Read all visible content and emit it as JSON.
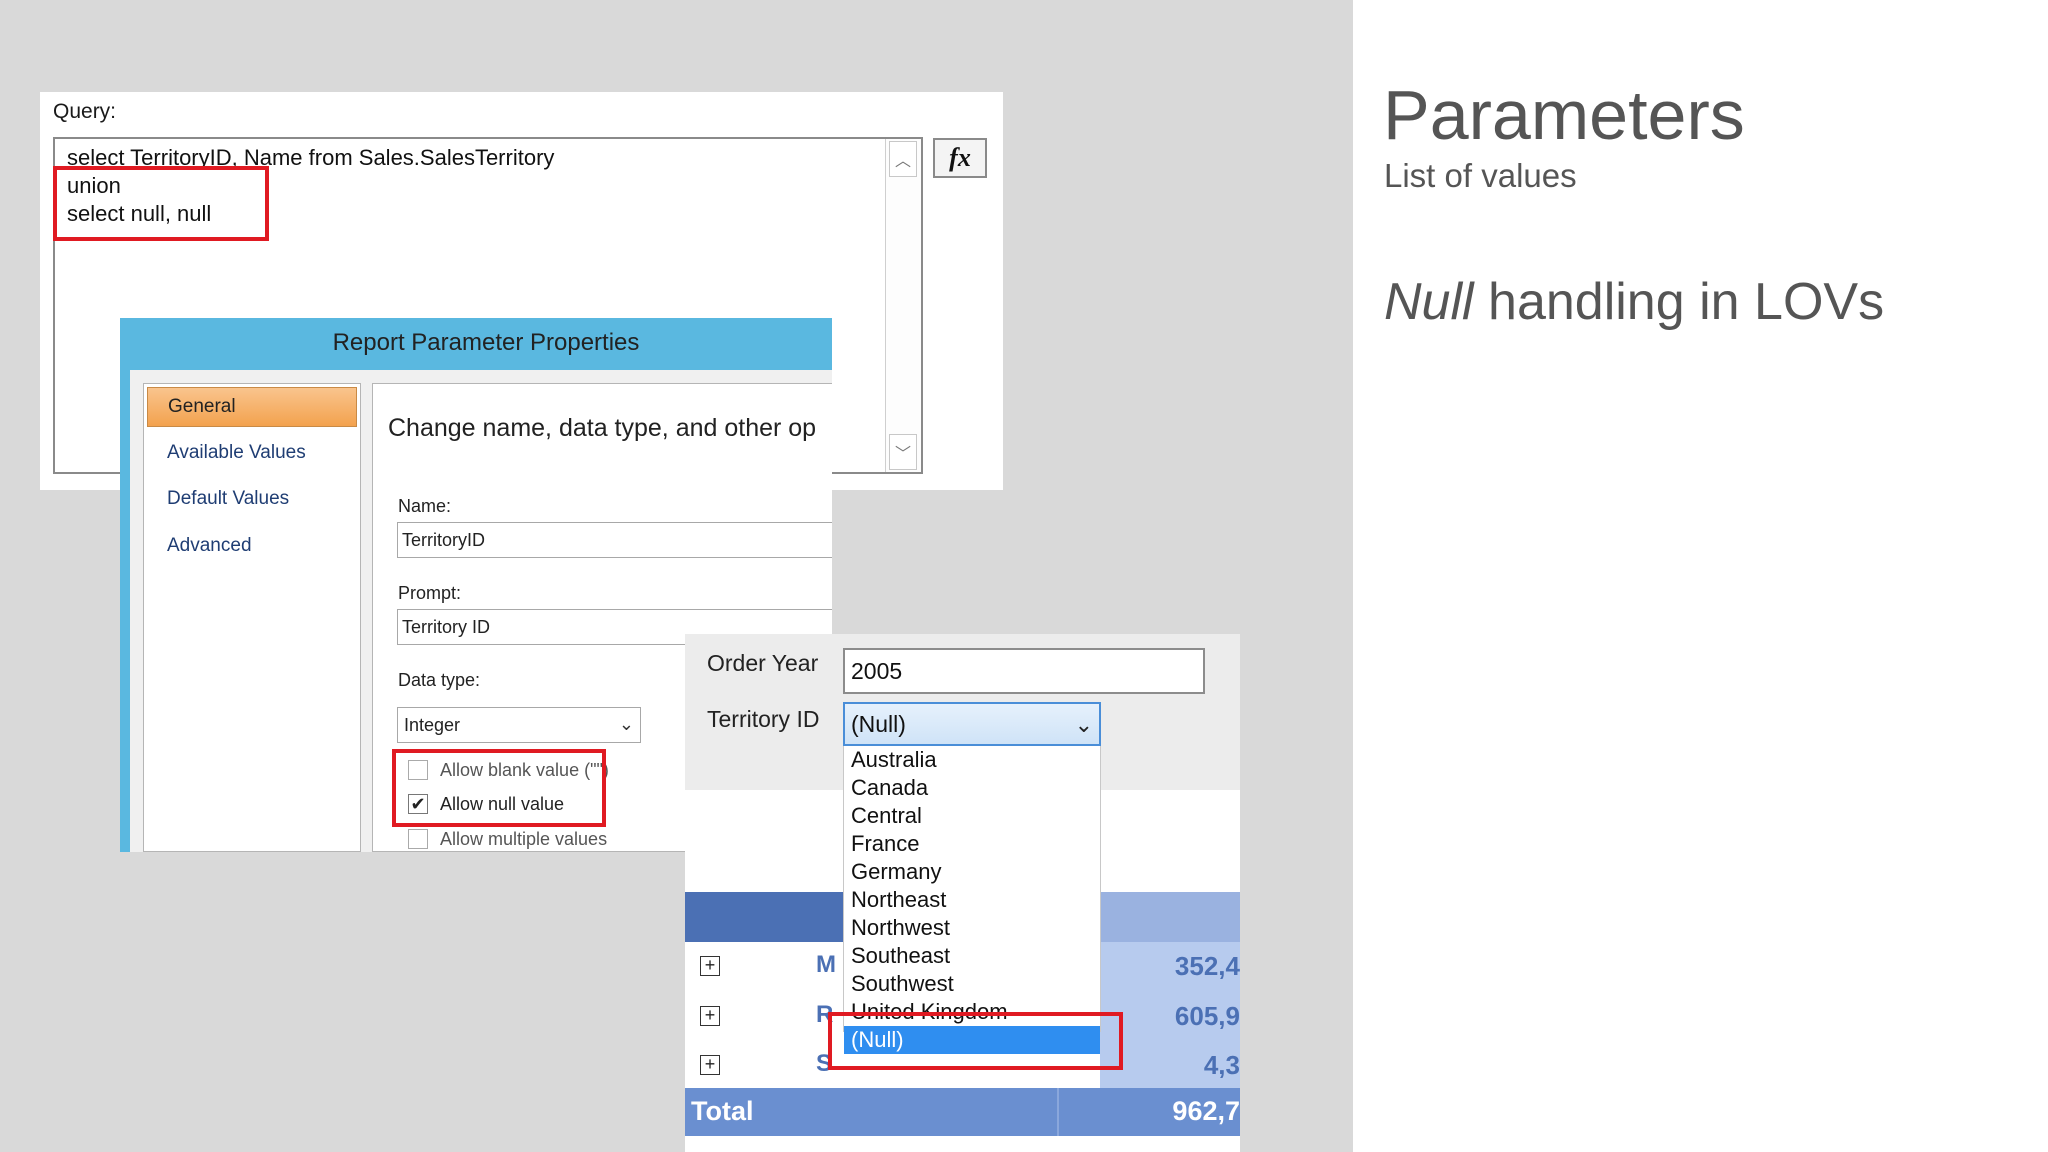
{
  "slide": {
    "title": "Parameters",
    "subtitle": "List of values",
    "topic_italic": "Null",
    "topic_rest": " handling in LOVs"
  },
  "query_panel": {
    "label": "Query:",
    "lines": [
      "select TerritoryID, Name from Sales.SalesTerritory",
      "union",
      "select null, null"
    ],
    "fx_label": "fx",
    "scroll_up": "︿",
    "scroll_down": "﹀"
  },
  "rpp_dialog": {
    "title": "Report Parameter Properties",
    "nav": [
      "General",
      "Available Values",
      "Default Values",
      "Advanced"
    ],
    "description": "Change name, data type, and other op",
    "name_label": "Name:",
    "name_value": "TerritoryID",
    "prompt_label": "Prompt:",
    "prompt_value": "Territory ID",
    "datatype_label": "Data type:",
    "datatype_value": "Integer",
    "checkboxes": [
      {
        "label": "Allow blank value (\"\")",
        "checked": false
      },
      {
        "label": "Allow null value",
        "checked": true
      },
      {
        "label": "Allow multiple values",
        "checked": false
      }
    ]
  },
  "viewer": {
    "order_year_label": "Order Year",
    "order_year_value": "2005",
    "territory_label": "Territory ID",
    "territory_value": "(Null)",
    "territory_options": [
      "Australia",
      "Canada",
      "Central",
      "France",
      "Germany",
      "Northeast",
      "Northwest",
      "Southeast",
      "Southwest",
      "United Kingdom",
      "(Null)"
    ],
    "rows": [
      {
        "initial": "M",
        "value": "352,4"
      },
      {
        "initial": "R",
        "value": "605,9"
      },
      {
        "initial": "S",
        "value": "4,3"
      }
    ],
    "total_label": "Total",
    "total_value": "962,7",
    "expand_glyph": "+"
  },
  "colors": {
    "highlight": "#e01a22",
    "dialog_title_bar": "#5ab8e0",
    "table_header": "#4b70b4",
    "selected_option": "#2f8ef0"
  }
}
